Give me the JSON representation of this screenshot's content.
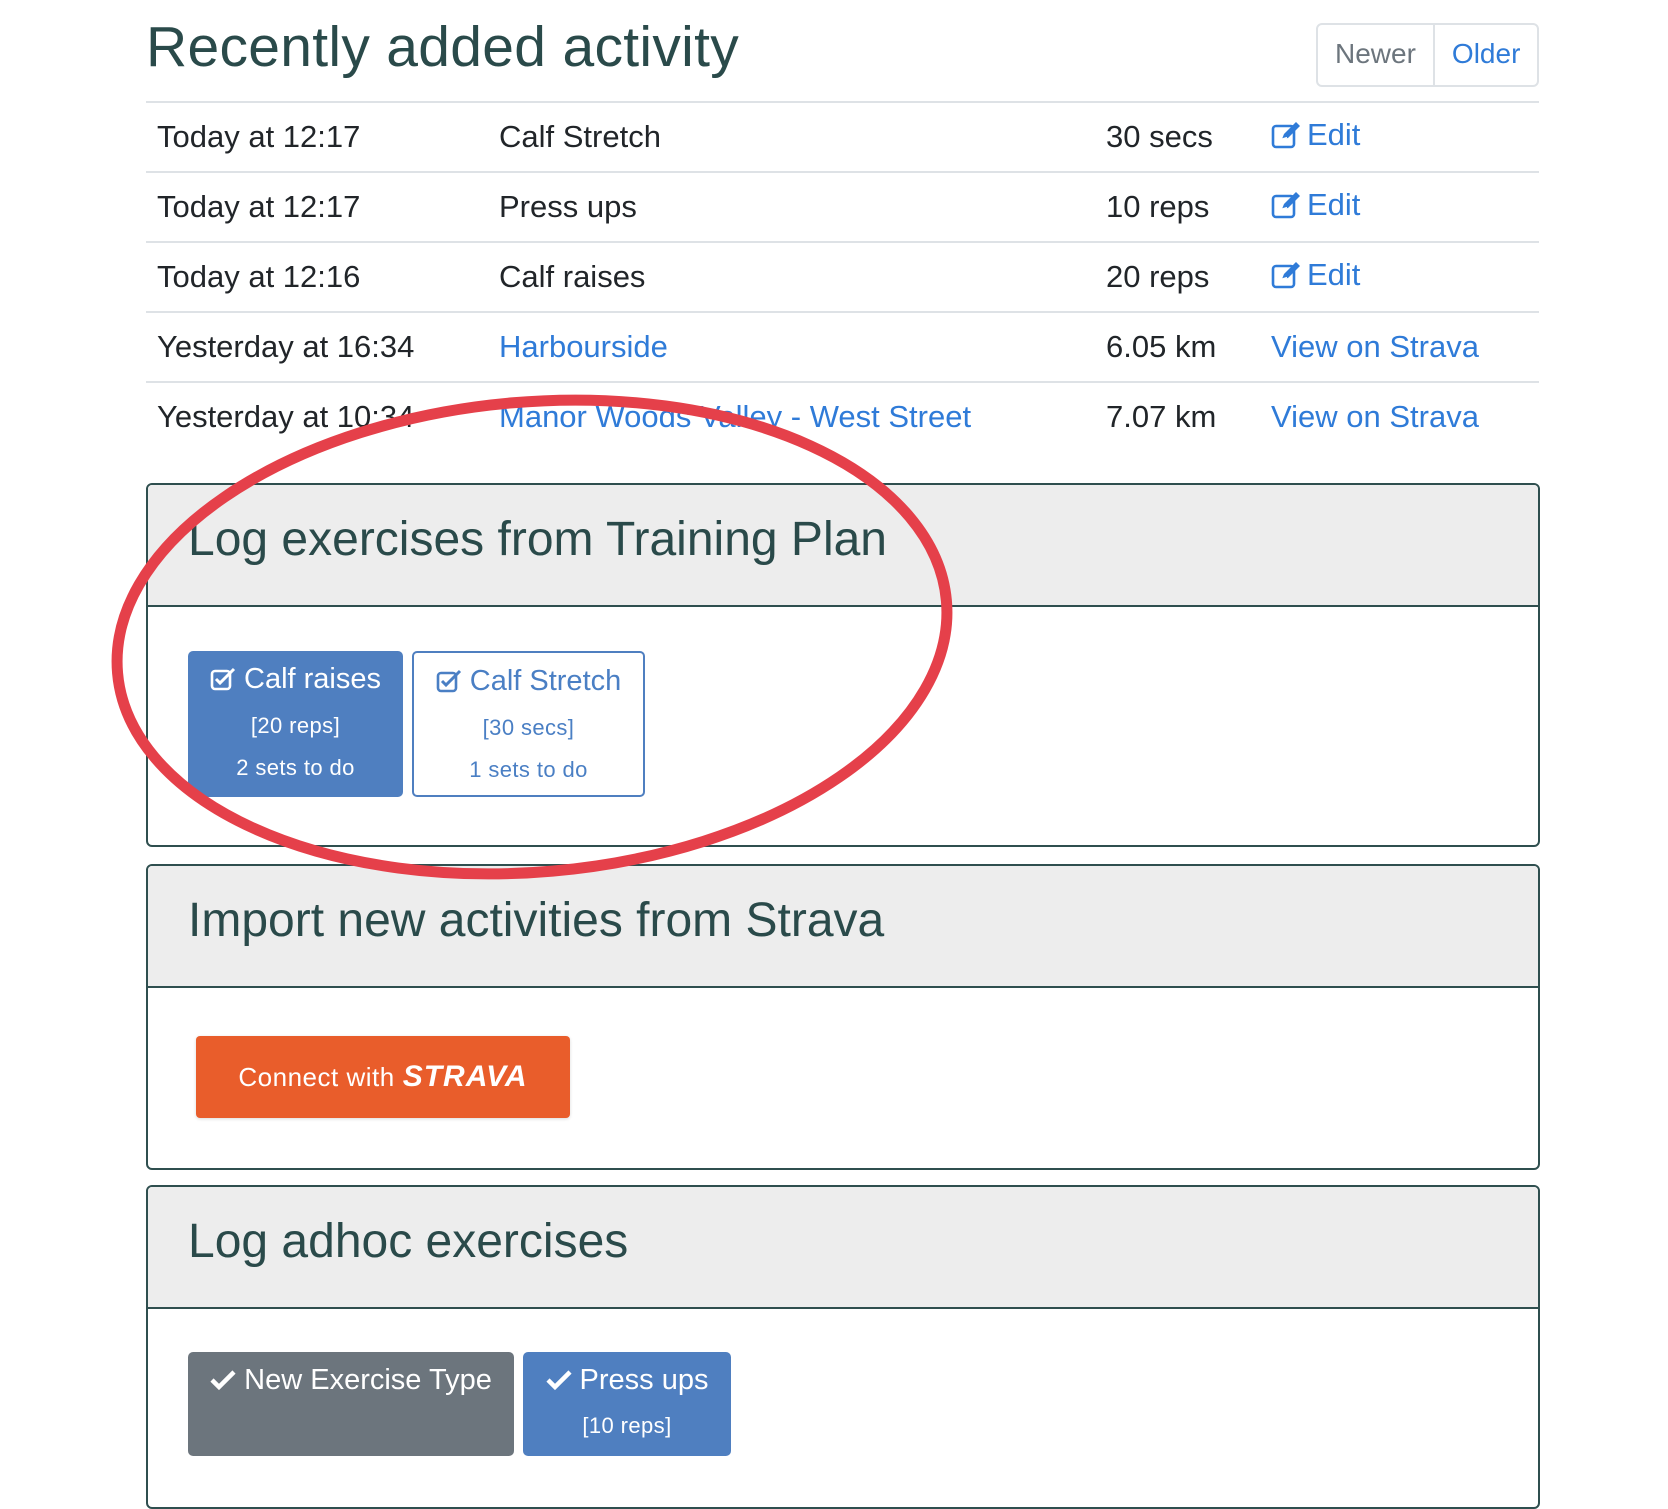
{
  "header": {
    "title": "Recently added activity",
    "pager": {
      "newer_label": "Newer",
      "older_label": "Older"
    }
  },
  "activities": [
    {
      "when": "Today at 12:17",
      "name": "Calf Stretch",
      "amount": "30 secs",
      "action": "Edit"
    },
    {
      "when": "Today at 12:17",
      "name": "Press ups",
      "amount": "10 reps",
      "action": "Edit"
    },
    {
      "when": "Today at 12:16",
      "name": "Calf raises",
      "amount": "20 reps",
      "action": "Edit"
    },
    {
      "when": "Yesterday at 16:34",
      "name": "Harbourside",
      "amount": "6.05 km",
      "action": "View on Strava"
    },
    {
      "when": "Yesterday at 10:34",
      "name": "Manor Woods Valley - West Street",
      "amount": "7.07 km",
      "action": "View on Strava"
    }
  ],
  "training_plan": {
    "title": "Log exercises from Training Plan",
    "buttons": [
      {
        "label": "Calf raises",
        "detail": "[20 reps]",
        "sets": "2 sets to do"
      },
      {
        "label": "Calf Stretch",
        "detail": "[30 secs]",
        "sets": "1 sets to do"
      }
    ]
  },
  "strava_import": {
    "title": "Import new activities from Strava",
    "connect_prefix": "Connect with",
    "connect_brand": "STRAVA"
  },
  "adhoc": {
    "title": "Log adhoc exercises",
    "buttons": [
      {
        "label": "New Exercise Type"
      },
      {
        "label": "Press ups",
        "detail": "[10 reps]"
      }
    ]
  },
  "colors": {
    "heading": "#2a4a4a",
    "link": "#2f7bd8",
    "primary_button": "#4f7fc0",
    "secondary_button": "#6c757d",
    "strava_orange": "#e95d2b",
    "annotation_red": "#e5404a"
  },
  "icons": {
    "edit": "edit-icon",
    "plan_check": "check-square-icon",
    "adhoc_check": "check-icon"
  }
}
